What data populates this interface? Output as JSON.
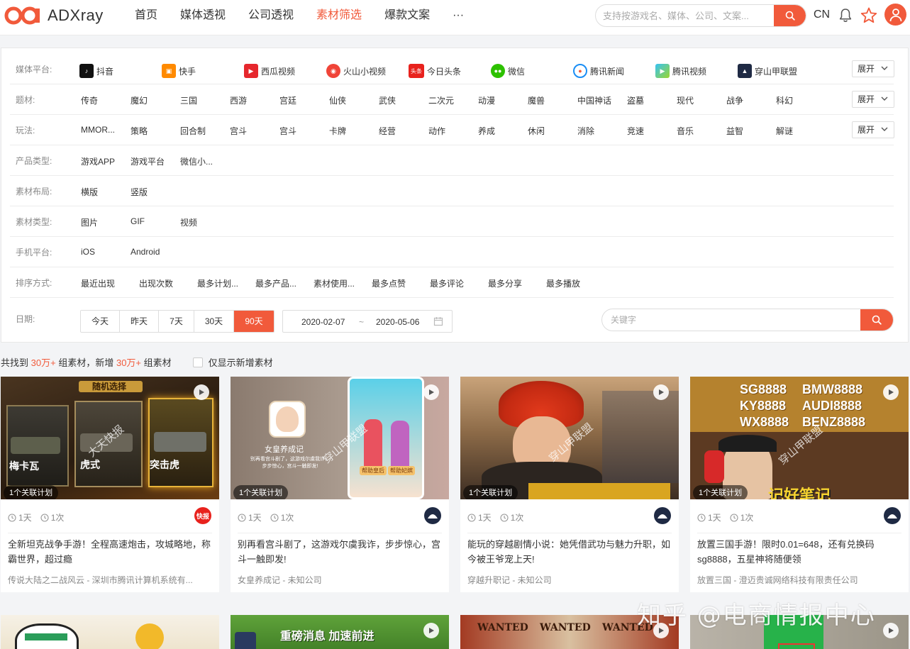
{
  "brand": {
    "name": "ADXray"
  },
  "nav": [
    "首页",
    "媒体透视",
    "公司透视",
    "素材筛选",
    "爆款文案",
    "···"
  ],
  "search": {
    "placeholder": "支持按游戏名、媒体、公司、文案..."
  },
  "lang": "CN",
  "colors": {
    "accent": "#f15a3b"
  },
  "filters": {
    "expand_label": "展开",
    "media_label": "媒体平台:",
    "media": [
      {
        "name": "抖音",
        "icon": "douyin-icon"
      },
      {
        "name": "快手",
        "icon": "kuaishou-icon"
      },
      {
        "name": "西瓜视频",
        "icon": "xigua-icon"
      },
      {
        "name": "火山小视频",
        "icon": "huoshan-icon"
      },
      {
        "name": "今日头条",
        "icon": "toutiao-icon",
        "badge": "头条"
      },
      {
        "name": "微信",
        "icon": "wechat-icon"
      },
      {
        "name": "腾讯新闻",
        "icon": "tencent-news-icon"
      },
      {
        "name": "腾讯视频",
        "icon": "tencent-video-icon"
      },
      {
        "name": "穿山甲联盟",
        "icon": "pangle-icon"
      }
    ],
    "theme_label": "题材:",
    "themes": [
      "传奇",
      "魔幻",
      "三国",
      "西游",
      "宫廷",
      "仙侠",
      "武侠",
      "二次元",
      "动漫",
      "魔兽",
      "中国神话",
      "盗墓",
      "现代",
      "战争",
      "科幻"
    ],
    "play_label": "玩法:",
    "plays": [
      "MMOR...",
      "策略",
      "回合制",
      "宫斗",
      "宫斗",
      "卡牌",
      "经营",
      "动作",
      "养成",
      "休闲",
      "消除",
      "竞速",
      "音乐",
      "益智",
      "解谜"
    ],
    "product_label": "产品类型:",
    "products": [
      "游戏APP",
      "游戏平台",
      "微信小..."
    ],
    "layout_label": "素材布局:",
    "layouts": [
      "横版",
      "竖版"
    ],
    "material_label": "素材类型:",
    "materials": [
      "图片",
      "GIF",
      "视频"
    ],
    "device_label": "手机平台:",
    "devices": [
      "iOS",
      "Android"
    ],
    "sort_label": "排序方式:",
    "sorts": [
      "最近出现",
      "出现次数",
      "最多计划...",
      "最多产品...",
      "素材使用...",
      "最多点赞",
      "最多评论",
      "最多分享",
      "最多播放"
    ],
    "date_label": "日期:",
    "date_buttons": [
      "今天",
      "昨天",
      "7天",
      "30天",
      "90天"
    ],
    "date_active": "90天",
    "date_from": "2020-02-07",
    "date_sep": "~",
    "date_to": "2020-05-06",
    "keyword_placeholder": "关键字"
  },
  "summary": {
    "prefix": "共找到",
    "count1": "30万+",
    "mid": "组素材，新增",
    "count2": "30万+",
    "suffix": "组素材",
    "checkbox_label": "仅显示新增素材"
  },
  "cards": [
    {
      "plan": "1个关联计划",
      "days": "1天",
      "times": "1次",
      "publisher": "toutiao",
      "title": "全新坦克战争手游！全程高速炮击，攻城略地，称霸世界，超过瘾",
      "subtitle": "传说大陆之二战风云 - 深圳市腾讯计算机系统有...",
      "thumb": {
        "banner": "随机选择",
        "tanks": [
          "梅卡瓦",
          "虎式",
          "突击虎"
        ],
        "watermark": "大天快报"
      }
    },
    {
      "plan": "1个关联计划",
      "days": "1天",
      "times": "1次",
      "publisher": "pangle",
      "title": "别再看宫斗剧了，这游戏尔虞我诈，步步惊心，宫斗一触即发!",
      "subtitle": "女皇养成记 - 未知公司",
      "thumb": {
        "app_name": "女皇养成记",
        "desc": "别再看宫斗剧了，这游戏尔虞我诈，步步惊心，宫斗一触即发!",
        "btn1": "帮助皇后",
        "btn2": "帮助妃嫔",
        "watermark": "穿山甲联盟"
      }
    },
    {
      "plan": "1个关联计划",
      "days": "1天",
      "times": "1次",
      "publisher": "pangle",
      "title": "能玩的穿越剧情小说：她凭借武功与魅力升职，如今被王爷宠上天!",
      "subtitle": "穿越升职记 - 未知公司",
      "thumb": {
        "watermark": "穿山甲联盟"
      }
    },
    {
      "plan": "1个关联计划",
      "days": "1天",
      "times": "1次",
      "publisher": "pangle",
      "title": "放置三国手游！限时0.01=648，还有兑换码sg8888，五星神将随便领",
      "subtitle": "放置三国 - 澄迈贵诚网络科技有限责任公司",
      "thumb": {
        "codes": [
          "SG8888",
          "BMW8888",
          "KY8888",
          "AUDI8888",
          "WX8888",
          "BENZ8888"
        ],
        "caption": "记好笔记",
        "watermark": "穿山甲联盟"
      }
    }
  ],
  "row2": [
    {
      "thumb_text": ""
    },
    {
      "thumb_text": "重磅消息 加速前进"
    },
    {
      "thumb_text": "WANTED"
    },
    {
      "thumb_text": ""
    }
  ],
  "watermark": "知乎 @电商情报中心"
}
